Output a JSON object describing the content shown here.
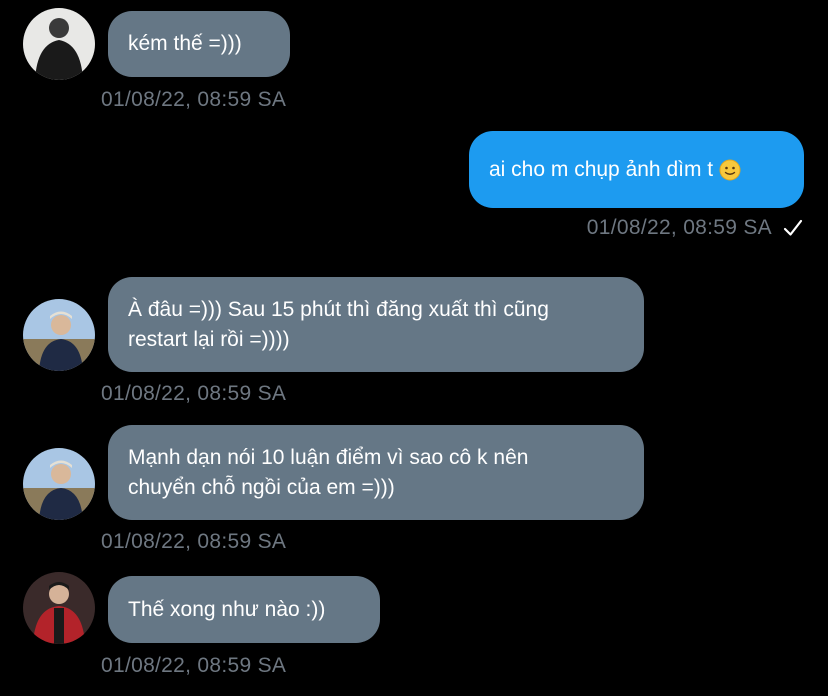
{
  "messages": [
    {
      "text": "kém thế =)))",
      "time": "01/08/22, 08:59 SA"
    },
    {
      "text": "ai cho m chụp ảnh dìm t",
      "emoji": "slight-smile-emoji-icon",
      "time": "01/08/22, 08:59 SA"
    },
    {
      "text": "À đâu =))) Sau 15 phút thì đăng xuất thì cũng\nrestart lại rồi =))))",
      "time": "01/08/22, 08:59 SA"
    },
    {
      "text": "Mạnh dạn nói 10 luận điểm vì sao cô k nên\nchuyển chỗ ngồi của em =)))",
      "time": "01/08/22, 08:59 SA"
    },
    {
      "text": "Thế xong như nào :))",
      "time": "01/08/22, 08:59 SA"
    }
  ],
  "colors": {
    "background": "#000000",
    "incoming_bubble": "#657786",
    "outgoing_bubble": "#1d9bf0",
    "timestamp": "#6e7781"
  }
}
